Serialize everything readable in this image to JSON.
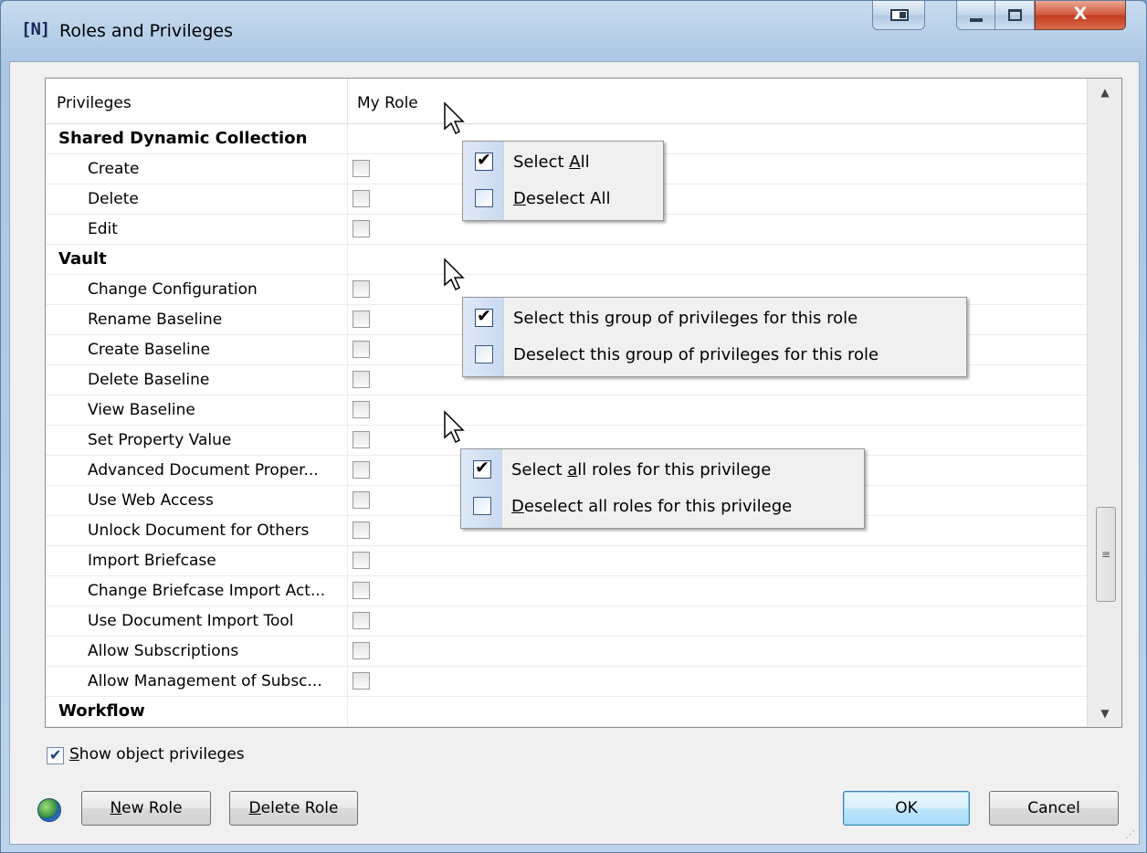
{
  "window": {
    "title": "Roles and Privileges",
    "app_icon_text": "[N]",
    "close_glyph": "X"
  },
  "grid": {
    "headers": {
      "privileges": "Privileges",
      "role": "My Role"
    },
    "rows": [
      {
        "label": "Shared Dynamic Collection",
        "type": "group"
      },
      {
        "label": "Create",
        "type": "item"
      },
      {
        "label": "Delete",
        "type": "item"
      },
      {
        "label": "Edit",
        "type": "item"
      },
      {
        "label": "Vault",
        "type": "group"
      },
      {
        "label": "Change Configuration",
        "type": "item"
      },
      {
        "label": "Rename Baseline",
        "type": "item"
      },
      {
        "label": "Create Baseline",
        "type": "item"
      },
      {
        "label": "Delete Baseline",
        "type": "item"
      },
      {
        "label": "View Baseline",
        "type": "item"
      },
      {
        "label": "Set Property Value",
        "type": "item"
      },
      {
        "label": "Advanced Document Proper...",
        "type": "item"
      },
      {
        "label": "Use Web Access",
        "type": "item"
      },
      {
        "label": "Unlock Document for Others",
        "type": "item"
      },
      {
        "label": "Import Briefcase",
        "type": "item"
      },
      {
        "label": "Change Briefcase Import Act...",
        "type": "item"
      },
      {
        "label": "Use Document Import Tool",
        "type": "item"
      },
      {
        "label": "Allow Subscriptions",
        "type": "item"
      },
      {
        "label": "Allow Management of Subsc...",
        "type": "item"
      },
      {
        "label": "Workflow",
        "type": "group"
      }
    ]
  },
  "menus": {
    "header": {
      "select_pre": "Select ",
      "select_key": "A",
      "select_post": "ll",
      "deselect_pre": "",
      "deselect_key": "D",
      "deselect_post": "eselect All"
    },
    "group": {
      "select": "Select this group of privileges for this role",
      "deselect": "Deselect this group of privileges for this role"
    },
    "privilege": {
      "select_pre": "Select ",
      "select_key": "a",
      "select_post": "ll roles for this privilege",
      "deselect_pre": "",
      "deselect_key": "D",
      "deselect_post": "eselect all roles for this privilege"
    }
  },
  "footer": {
    "show_object_key": "S",
    "show_object_rest": "how object privileges",
    "new_role_key": "N",
    "new_role_rest": "ew Role",
    "delete_role_key": "D",
    "delete_role_rest": "elete Role",
    "ok": "OK",
    "cancel": "Cancel"
  }
}
